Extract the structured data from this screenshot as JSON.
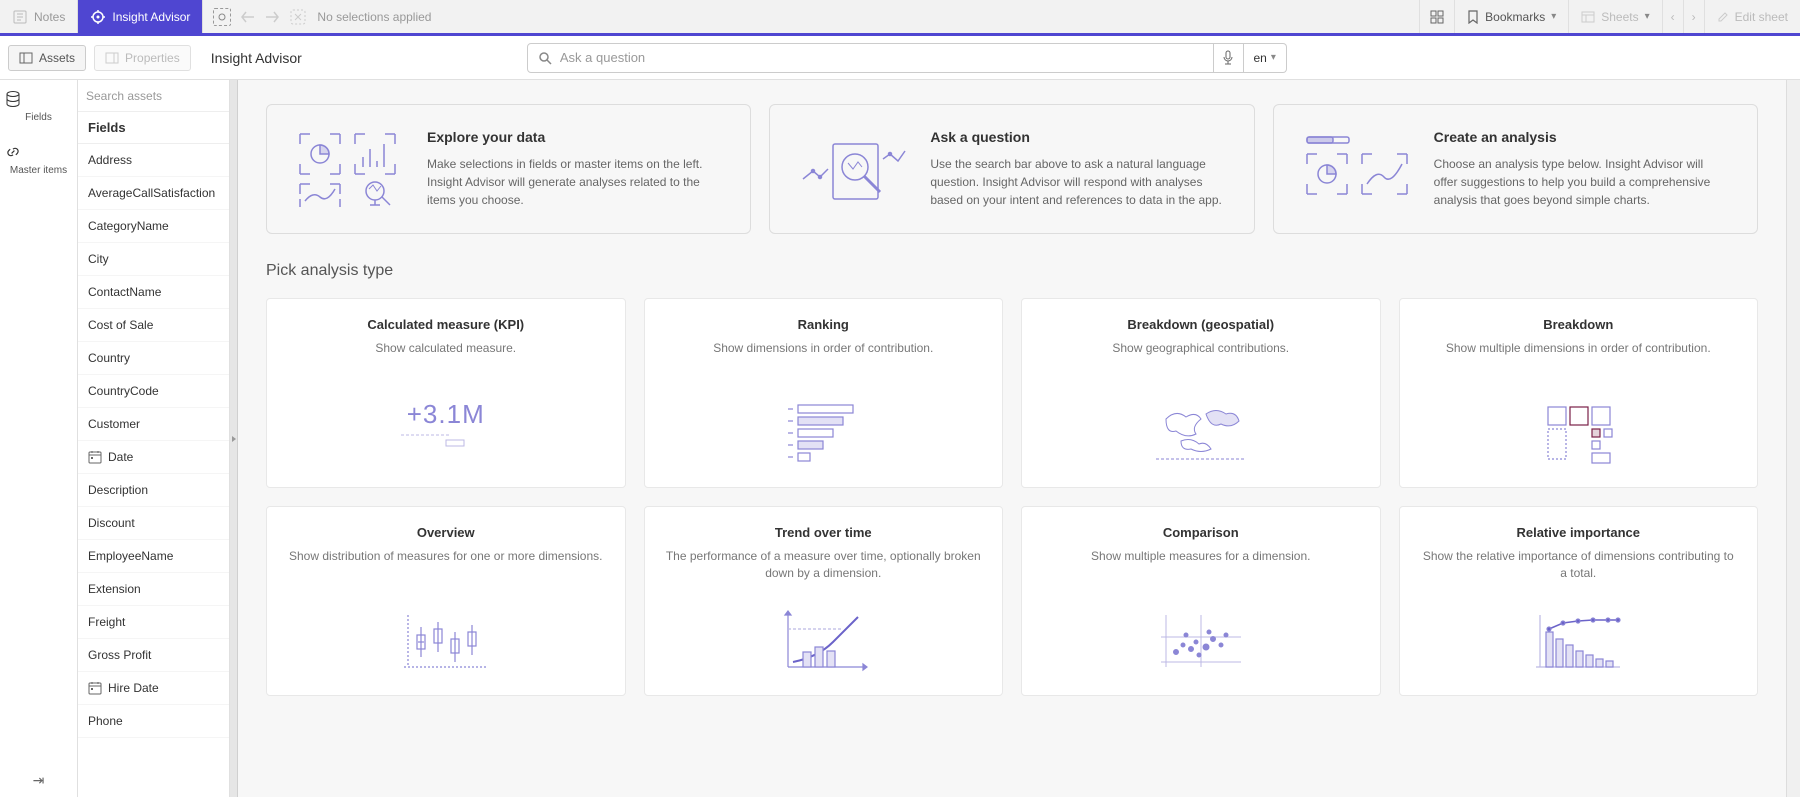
{
  "topbar": {
    "notes": "Notes",
    "insight_advisor": "Insight Advisor",
    "no_selections": "No selections applied",
    "bookmarks": "Bookmarks",
    "sheets": "Sheets",
    "edit_sheet": "Edit sheet"
  },
  "secondbar": {
    "assets": "Assets",
    "properties": "Properties",
    "title": "Insight Advisor",
    "search_placeholder": "Ask a question",
    "lang": "en"
  },
  "leftnav": {
    "fields": "Fields",
    "master_items": "Master items"
  },
  "fieldsPanel": {
    "search_placeholder": "Search assets",
    "header": "Fields",
    "items": [
      {
        "label": "Address"
      },
      {
        "label": "AverageCallSatisfaction"
      },
      {
        "label": "CategoryName"
      },
      {
        "label": "City"
      },
      {
        "label": "ContactName"
      },
      {
        "label": "Cost of Sale"
      },
      {
        "label": "Country"
      },
      {
        "label": "CountryCode"
      },
      {
        "label": "Customer"
      },
      {
        "label": "Date",
        "icon": "calendar"
      },
      {
        "label": "Description"
      },
      {
        "label": "Discount"
      },
      {
        "label": "EmployeeName"
      },
      {
        "label": "Extension"
      },
      {
        "label": "Freight"
      },
      {
        "label": "Gross Profit"
      },
      {
        "label": "Hire Date",
        "icon": "calendar"
      },
      {
        "label": "Phone"
      }
    ]
  },
  "intro": [
    {
      "title": "Explore your data",
      "desc": "Make selections in fields or master items on the left. Insight Advisor will generate analyses related to the items you choose."
    },
    {
      "title": "Ask a question",
      "desc": "Use the search bar above to ask a natural language question. Insight Advisor will respond with analyses based on your intent and references to data in the app."
    },
    {
      "title": "Create an analysis",
      "desc": "Choose an analysis type below. Insight Advisor will offer suggestions to help you build a comprehensive analysis that goes beyond simple charts."
    }
  ],
  "pick_title": "Pick analysis type",
  "analysis": [
    {
      "title": "Calculated measure (KPI)",
      "desc": "Show calculated measure."
    },
    {
      "title": "Ranking",
      "desc": "Show dimensions in order of contribution."
    },
    {
      "title": "Breakdown (geospatial)",
      "desc": "Show geographical contributions."
    },
    {
      "title": "Breakdown",
      "desc": "Show multiple dimensions in order of contribution."
    },
    {
      "title": "Overview",
      "desc": "Show distribution of measures for one or more dimensions."
    },
    {
      "title": "Trend over time",
      "desc": "The performance of a measure over time, optionally broken down by a dimension."
    },
    {
      "title": "Comparison",
      "desc": "Show multiple measures for a dimension."
    },
    {
      "title": "Relative importance",
      "desc": "Show the relative importance of dimensions contributing to a total."
    }
  ],
  "kpi_value": "+3.1M"
}
